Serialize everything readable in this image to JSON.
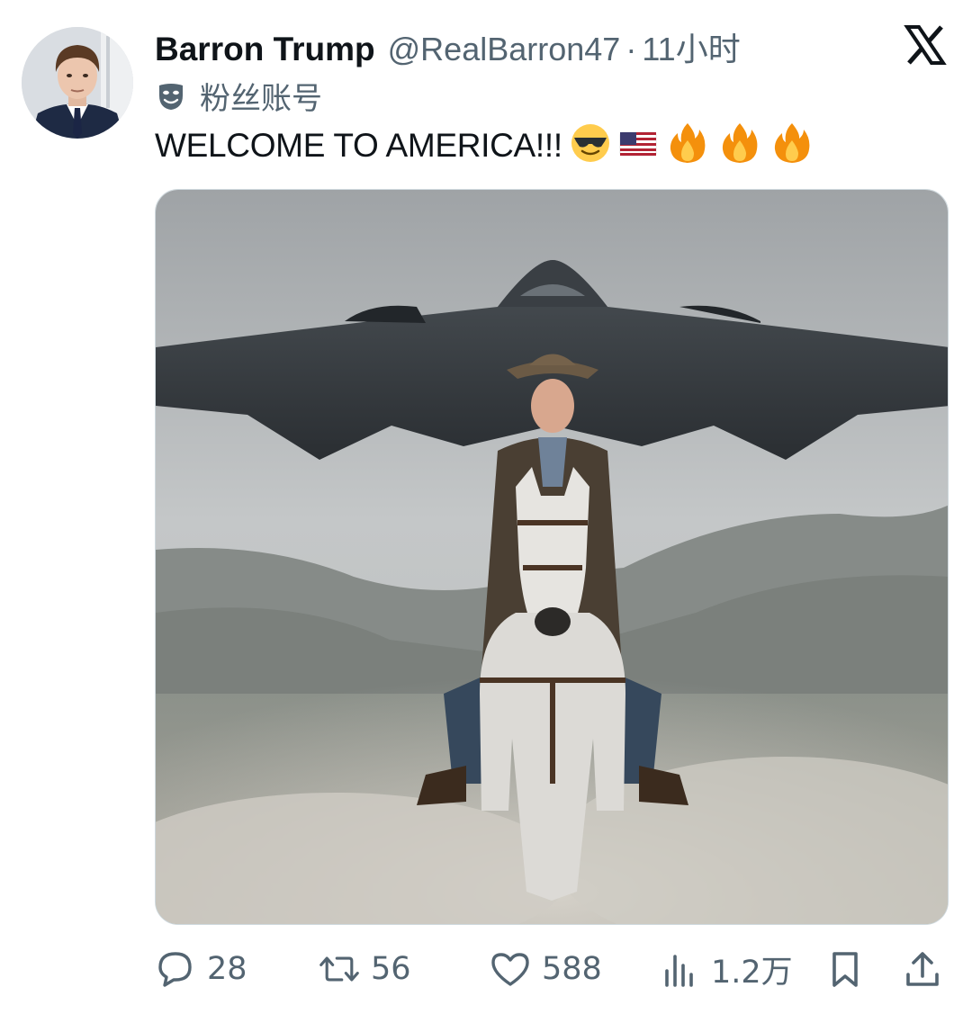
{
  "tweet": {
    "display_name": "Barron Trump",
    "handle": "@RealBarron47",
    "separator": "·",
    "time": "11小时",
    "account_label": "粉丝账号",
    "text": "WELCOME TO AMERICA!!!",
    "emojis": [
      "smiling-face-with-sunglasses",
      "us-flag",
      "fire",
      "fire",
      "fire"
    ]
  },
  "actions": {
    "replies": "28",
    "reposts": "56",
    "likes": "588",
    "views": "1.2万"
  },
  "colors": {
    "text_primary": "#0f1419",
    "text_secondary": "#536471",
    "border": "#cfd9de"
  }
}
